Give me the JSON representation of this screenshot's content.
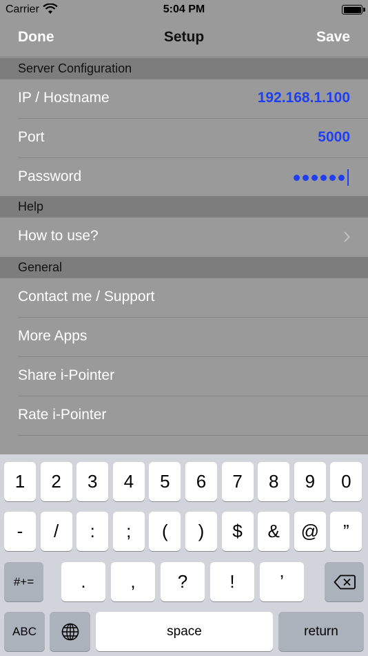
{
  "status_bar": {
    "carrier": "Carrier",
    "time": "5:04 PM"
  },
  "nav": {
    "left": "Done",
    "title": "Setup",
    "right": "Save"
  },
  "sections": {
    "server": {
      "header": "Server Configuration",
      "ip_label": "IP / Hostname",
      "ip_value": "192.168.1.100",
      "port_label": "Port",
      "port_value": "5000",
      "password_label": "Password",
      "password_length": 6
    },
    "help": {
      "header": "Help",
      "how_to": "How to use?"
    },
    "general": {
      "header": "General",
      "items": [
        "Contact me / Support",
        "More Apps",
        "Share i-Pointer",
        "Rate i-Pointer"
      ]
    }
  },
  "keyboard": {
    "row1": [
      "1",
      "2",
      "3",
      "4",
      "5",
      "6",
      "7",
      "8",
      "9",
      "0"
    ],
    "row2": [
      "-",
      "/",
      ":",
      ";",
      "(",
      ")",
      "$",
      "&",
      "@",
      "”"
    ],
    "row3_left": "#+=",
    "row3": [
      ".",
      ",",
      "?",
      "!",
      "’"
    ],
    "abc": "ABC",
    "space": "space",
    "return": "return",
    "icons": {
      "globe": "globe-icon",
      "delete": "backspace-icon",
      "chevron": "chevron-right-icon",
      "wifi": "wifi-icon",
      "battery": "battery-icon"
    }
  }
}
